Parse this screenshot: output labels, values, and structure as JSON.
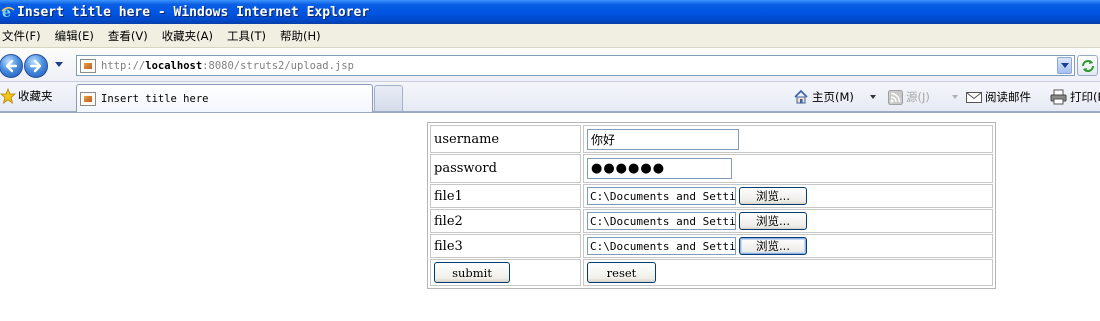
{
  "window": {
    "title": "Insert title here - Windows Internet Explorer"
  },
  "menu": {
    "items": [
      {
        "label": "文件(F)"
      },
      {
        "label": "编辑(E)"
      },
      {
        "label": "查看(V)"
      },
      {
        "label": "收藏夹(A)"
      },
      {
        "label": "工具(T)"
      },
      {
        "label": "帮助(H)"
      }
    ]
  },
  "address": {
    "prefix": "http://",
    "host": "localhost",
    "rest": ":8080/struts2/upload.jsp"
  },
  "favorites": {
    "label": "收藏夹"
  },
  "tab": {
    "title": "Insert title here"
  },
  "commands": {
    "home": "主页(M)",
    "feeds": "源(J)",
    "read_mail": "阅读邮件",
    "print": "打印(R)"
  },
  "form": {
    "rows": [
      {
        "label": "username",
        "value": "你好"
      },
      {
        "label": "password",
        "value": "●●●●●●"
      },
      {
        "label": "file1",
        "value": "C:\\Documents and Settings",
        "button": "浏览..."
      },
      {
        "label": "file2",
        "value": "C:\\Documents and Settings",
        "button": "浏览..."
      },
      {
        "label": "file3",
        "value": "C:\\Documents and Settings",
        "button": "浏览..."
      }
    ],
    "submit_label": "submit",
    "reset_label": "reset"
  },
  "colors": {
    "titlebar": "#0054e3",
    "menubar": "#f1efe2",
    "button_border": "#003c74"
  }
}
